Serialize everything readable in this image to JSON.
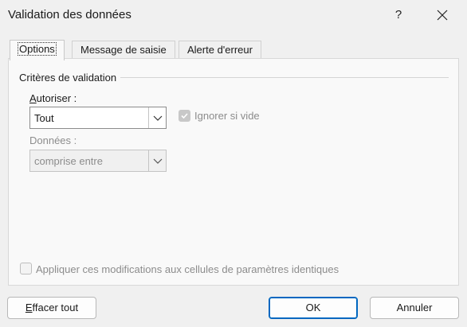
{
  "window": {
    "title": "Validation des données",
    "help_label": "?"
  },
  "tabs": [
    {
      "label": "Options",
      "active": true
    },
    {
      "label": "Message de saisie",
      "active": false
    },
    {
      "label": "Alerte d'erreur",
      "active": false
    }
  ],
  "criteria": {
    "group_label": "Critères de validation",
    "allow": {
      "label_first": "A",
      "label_rest": "utoriser :",
      "value": "Tout"
    },
    "ignore_blank": {
      "label": "Ignorer si vide",
      "checked": true,
      "enabled": false
    },
    "data": {
      "label": "Données :",
      "value": "comprise entre",
      "enabled": false
    }
  },
  "apply_all": {
    "label": "Appliquer ces modifications aux cellules de paramètres identiques",
    "checked": false,
    "enabled": false
  },
  "buttons": {
    "clear_first": "E",
    "clear_rest": "ffacer tout",
    "ok": "OK",
    "cancel": "Annuler"
  },
  "colors": {
    "accent": "#0067c0",
    "disabled_text": "#8c8c8c"
  }
}
